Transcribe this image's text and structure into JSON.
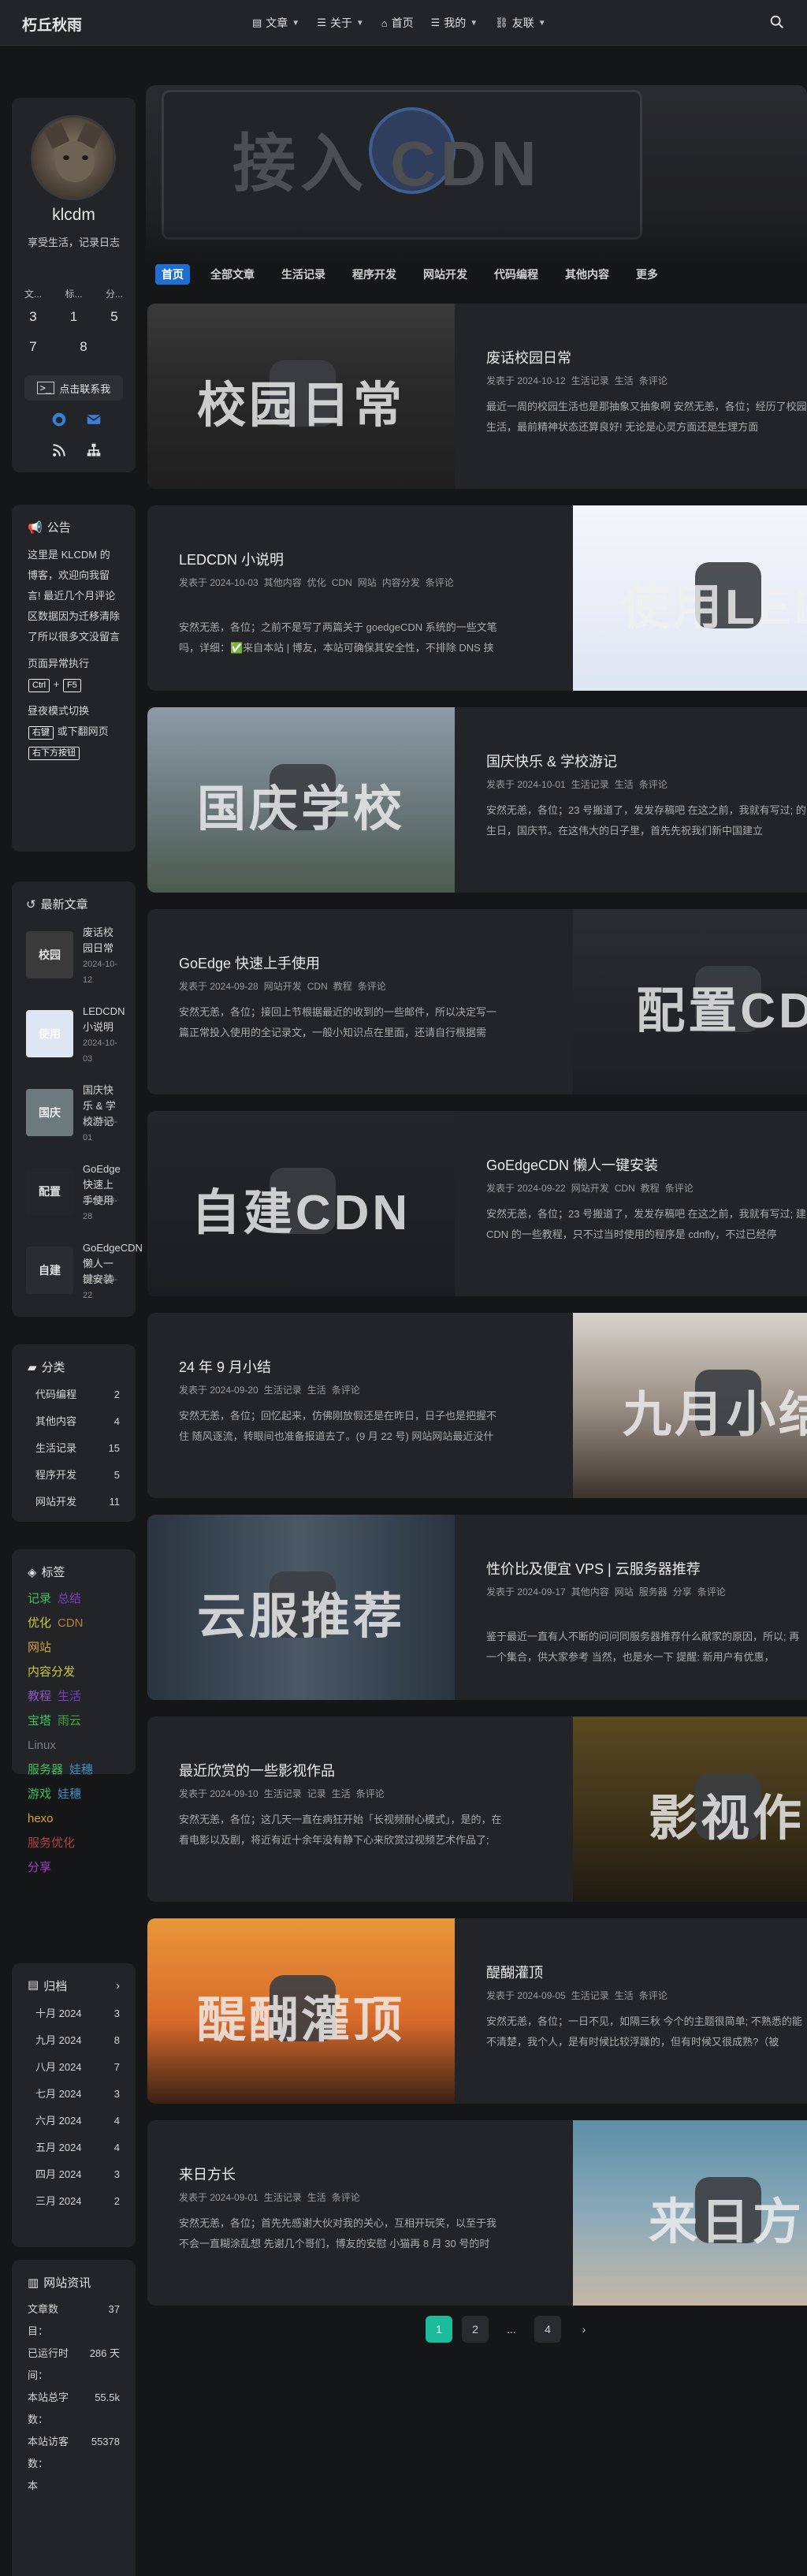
{
  "site": {
    "logo": "朽丘秋雨"
  },
  "nav": [
    {
      "icon": "book-icon",
      "label": "文章"
    },
    {
      "icon": "list-icon",
      "label": "关于"
    },
    {
      "icon": "home-icon",
      "label": "首页"
    },
    {
      "icon": "list-icon",
      "label": "我的"
    },
    {
      "icon": "link-icon",
      "label": "友联"
    }
  ],
  "hero": {
    "text": "接入 CDN"
  },
  "category_tabs": [
    {
      "label": "首页",
      "active": true
    },
    {
      "label": "全部文章"
    },
    {
      "label": "生活记录"
    },
    {
      "label": "程序开发"
    },
    {
      "label": "网站开发"
    },
    {
      "label": "代码编程"
    },
    {
      "label": "其他内容"
    },
    {
      "label": "更多"
    }
  ],
  "profile": {
    "name": "klcdm",
    "bio": "享受生活，记录日志",
    "stats_labels": [
      "文...",
      "标...",
      "分..."
    ],
    "stats_row1": [
      "3",
      "1",
      "5"
    ],
    "stats_row2": [
      "7",
      "8"
    ],
    "follow_label": "点击联系我"
  },
  "notice": {
    "title": "公告",
    "p1": "这里是 KLCDM 的博客，欢迎向我留言! 最近几个月评论区数据因为迁移清除了所以很多文没留言",
    "p2_prefix": "页面异常执行",
    "p2_key1": "Ctrl",
    "p2_plus": "+",
    "p2_key2": "F5",
    "p3_prefix": "昼夜模式切换",
    "p3_key": "右键",
    "p3_mid": "或下翻网页",
    "p3_key2": "右下方按钮"
  },
  "recent": {
    "title": "最新文章",
    "items": [
      {
        "title": "废话校园日常",
        "date": "2024-10-12",
        "thumb_text": "校园"
      },
      {
        "title": "LEDCDN 小说明",
        "date": "2024-10-03",
        "thumb_text": "使用"
      },
      {
        "title": "国庆快乐 & 学校游记",
        "date": "2024-10-01",
        "thumb_text": "国庆"
      },
      {
        "title": "GoEdge 快速上手使用",
        "date": "2024-09-28",
        "thumb_text": "配置"
      },
      {
        "title": "GoEdgeCDN 懒人一键安装",
        "date": "2024-09-22",
        "thumb_text": "自建"
      }
    ]
  },
  "categories": {
    "title": "分类",
    "items": [
      {
        "name": "代码编程",
        "count": "2"
      },
      {
        "name": "其他内容",
        "count": "4"
      },
      {
        "name": "生活记录",
        "count": "15"
      },
      {
        "name": "程序开发",
        "count": "5"
      },
      {
        "name": "网站开发",
        "count": "11"
      }
    ]
  },
  "tags": {
    "title": "标签",
    "lines": [
      [
        {
          "name": "记录",
          "color": "#3fbf5f"
        },
        {
          "name": "总结",
          "color": "#7b3fbf"
        }
      ],
      [
        {
          "name": "优化",
          "color": "#c9c93f"
        },
        {
          "name": "CDN",
          "color": "#b7803a"
        }
      ],
      [
        {
          "name": "网站",
          "color": "#d8a23a"
        }
      ],
      [
        {
          "name": "内容分发",
          "color": "#c9c93f"
        }
      ],
      [
        {
          "name": "教程",
          "color": "#8a57c8"
        },
        {
          "name": "生活",
          "color": "#7b3fbf"
        }
      ],
      [
        {
          "name": "宝塔",
          "color": "#3fbf5f"
        },
        {
          "name": "雨云",
          "color": "#3fa23f"
        }
      ],
      [
        {
          "name": "Linux",
          "color": "#7c7c7c"
        }
      ],
      [
        {
          "name": "服务器",
          "color": "#3fbf5f"
        },
        {
          "name": "娃穗",
          "color": "#3f8fbf"
        }
      ],
      [
        {
          "name": "游戏",
          "color": "#3fbf5f"
        },
        {
          "name": "娃穗",
          "color": "#3f8fbf"
        }
      ],
      [
        {
          "name": "hexo",
          "color": "#d8a23a"
        }
      ],
      [
        {
          "name": "服务优化",
          "color": "#b03f3f"
        }
      ],
      [
        {
          "name": "分享",
          "color": "#a03fbf"
        }
      ]
    ]
  },
  "archive": {
    "title": "归档",
    "items": [
      {
        "month": "十月 2024",
        "count": "3"
      },
      {
        "month": "九月 2024",
        "count": "8"
      },
      {
        "month": "八月 2024",
        "count": "7"
      },
      {
        "month": "七月 2024",
        "count": "3"
      },
      {
        "month": "六月 2024",
        "count": "4"
      },
      {
        "month": "五月 2024",
        "count": "4"
      },
      {
        "month": "四月 2024",
        "count": "3"
      },
      {
        "month": "三月 2024",
        "count": "2"
      }
    ]
  },
  "siteinfo": {
    "title": "网站资讯",
    "rows": [
      {
        "label": "文章数目：",
        "value": "37"
      },
      {
        "label": "已运行时间：",
        "value": "286 天"
      },
      {
        "label": "本站总字数：",
        "value": "55.5k"
      },
      {
        "label": "本站访客数：",
        "value": "55378"
      },
      {
        "label": "本",
        "value": ""
      }
    ]
  },
  "posts": [
    {
      "title": "废话校园日常",
      "meta": [
        "发表于 2024-10-12",
        "生活记录",
        "生活",
        "条评论"
      ],
      "excerpt": "最近一周的校园生活也是那抽象又抽象啊 安然无恙，各位；经历了校园生活，最前精神状态还算良好! 无论是心灵方面还是生理方面",
      "img_text": "校园日常",
      "img_bg": "linear-gradient(180deg,#3a3a3a 0%,#2a2a2a 40%,#1f1f1f 100%)",
      "layout": "left"
    },
    {
      "title": "LEDCDN 小说明",
      "meta": [
        "发表于 2024-10-03",
        "其他内容",
        "优化",
        "CDN",
        "网站",
        "内容分发",
        "条评论"
      ],
      "excerpt": "安然无恙，各位；之前不是写了两篇关于 goedgeCDN 系统的一些文笔吗，详细：✅来自本站 | 博友，本站可确保其安全性，不排除 DNS 挟持...",
      "img_text": "使用LED",
      "img_bg": "linear-gradient(180deg,#f4f6fb 0%,#dfe6f3 100%)",
      "layout": "right"
    },
    {
      "title": "国庆快乐 & 学校游记",
      "meta": [
        "发表于 2024-10-01",
        "生活记录",
        "生活",
        "条评论"
      ],
      "excerpt": "安然无恙，各位；23 号搬道了，发发存稿吧 在这之前，我就有写过; 的生日，国庆节。在这伟大的日子里，首先先祝我们新中国建立",
      "img_text": "国庆学校",
      "img_bg": "linear-gradient(180deg,#8c9aa6 0%,#6c7a7e 50%,#4c5a4f 100%)",
      "layout": "left"
    },
    {
      "title": "GoEdge 快速上手使用",
      "meta": [
        "发表于 2024-09-28",
        "网站开发",
        "CDN",
        "教程",
        "条评论"
      ],
      "excerpt": "安然无恙，各位；接回上节根据最近的收到的一些邮件，所以决定写一篇正常投入使用的全记录文，一般小知识点在里面，还请自行根据需求...",
      "img_text": "配置CD",
      "img_bg": "linear-gradient(180deg,#2a2c30 0%,#1d1f22 100%)",
      "layout": "right"
    },
    {
      "title": "GoEdgeCDN 懒人一键安装",
      "meta": [
        "发表于 2024-09-22",
        "网站开发",
        "CDN",
        "教程",
        "条评论"
      ],
      "excerpt": "安然无恙，各位；23 号搬道了，发发存稿吧 在这之前，我就有写过; 建 CDN 的一些教程，只不过当时使用的程序是 cdnfly，不过已经停",
      "img_text": "自建CDN",
      "img_bg": "linear-gradient(180deg,#24262a 0%,#1b1d20 100%)",
      "layout": "left"
    },
    {
      "title": "24 年 9 月小结",
      "meta": [
        "发表于 2024-09-20",
        "生活记录",
        "生活",
        "条评论"
      ],
      "excerpt": "安然无恙，各位；回忆起来，仿佛刚放假还是在昨日，日子也是把握不住 随风逐流，转眼间也准备报道去了。(9 月 22 号) 网站网站最近没什么...",
      "img_text": "九月小结",
      "img_bg": "linear-gradient(180deg,#d8d3cc 0%,#9a8f85 50%,#3c332d 100%)",
      "layout": "right"
    },
    {
      "title": "性价比及便宜 VPS | 云服务器推荐",
      "meta": [
        "发表于 2024-09-17",
        "其他内容",
        "网站",
        "服务器",
        "分享",
        "条评论"
      ],
      "excerpt": "鉴于最近一直有人不断的问问同服务器推荐什么献家的原因，所以; 再一个集合，供大家参考 当然，也是水一下 提醒: 新用户有优惠，",
      "img_text": "云服推荐",
      "img_bg": "linear-gradient(90deg,#2a3440 0%,#4a5866 50%,#2a3440 100%)",
      "layout": "left"
    },
    {
      "title": "最近欣赏的一些影视作品",
      "meta": [
        "发表于 2024-09-10",
        "生活记录",
        "记录",
        "生活",
        "条评论"
      ],
      "excerpt": "安然无恙，各位；这几天一直在病狂开始「长视频耐心模式」，是的，在看电影以及剧，将近有近十余年没有静下心来欣赏过视频艺术作品了; 主...",
      "img_text": "影视作",
      "img_bg": "linear-gradient(180deg,#5a4a22 0%,#3a2f18 60%,#1f1a12 100%)",
      "layout": "right"
    },
    {
      "title": "醍醐灌顶",
      "meta": [
        "发表于 2024-09-05",
        "生活记录",
        "生活",
        "条评论"
      ],
      "excerpt": "安然无恙，各位；一日不见，如隔三秋 今个的主题很简单; 不熟悉的能不清楚，我个人，是有时候比较浮躁的，但有时候又很成熟?（被",
      "img_text": "醍醐灌顶",
      "img_bg": "linear-gradient(180deg,#e8973a 0%,#d86a2a 55%,#3a2014 100%)",
      "layout": "left"
    },
    {
      "title": "来日方长",
      "meta": [
        "发表于 2024-09-01",
        "生活记录",
        "生活",
        "条评论"
      ],
      "excerpt": "安然无恙，各位；首先先感谢大伙对我的关心，互相开玩笑，以至于我不会一直糊涂乱想 先谢几个哥们，博友的安慰 小猫再 8 月 30 号的时候，...",
      "img_text": "来日方",
      "img_bg": "linear-gradient(180deg,#5c8fa8 0%,#8aa9b8 50%,#c4b8a8 100%)",
      "layout": "right"
    }
  ],
  "pagination": {
    "pages": [
      "1",
      "2",
      "...",
      "4"
    ],
    "active": "1",
    "next": "›"
  }
}
